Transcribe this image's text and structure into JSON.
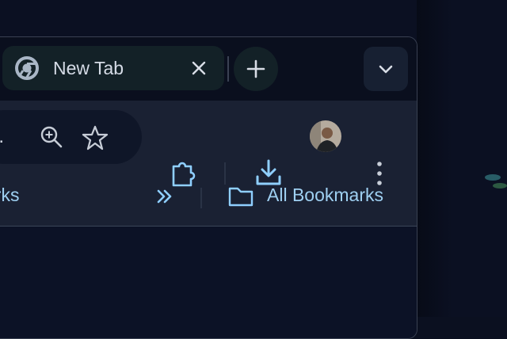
{
  "tab": {
    "title": "New Tab",
    "favicon": "chrome-icon"
  },
  "tabstrip": {
    "newtab": "plus-icon",
    "tabsearch": "chevron-down-icon"
  },
  "toolbar": {
    "omnibox_ellipsis": "...",
    "icons": [
      "zoom-icon",
      "star-icon",
      "extensions-icon",
      "download-icon",
      "avatar",
      "more-vert-icon"
    ]
  },
  "bookmarks": {
    "partial_label": "arks",
    "all_bookmarks": "All Bookmarks"
  },
  "colors": {
    "accent": "#8fcfff",
    "tab_bg": "#132127",
    "toolbar_bg": "#1a2133"
  }
}
